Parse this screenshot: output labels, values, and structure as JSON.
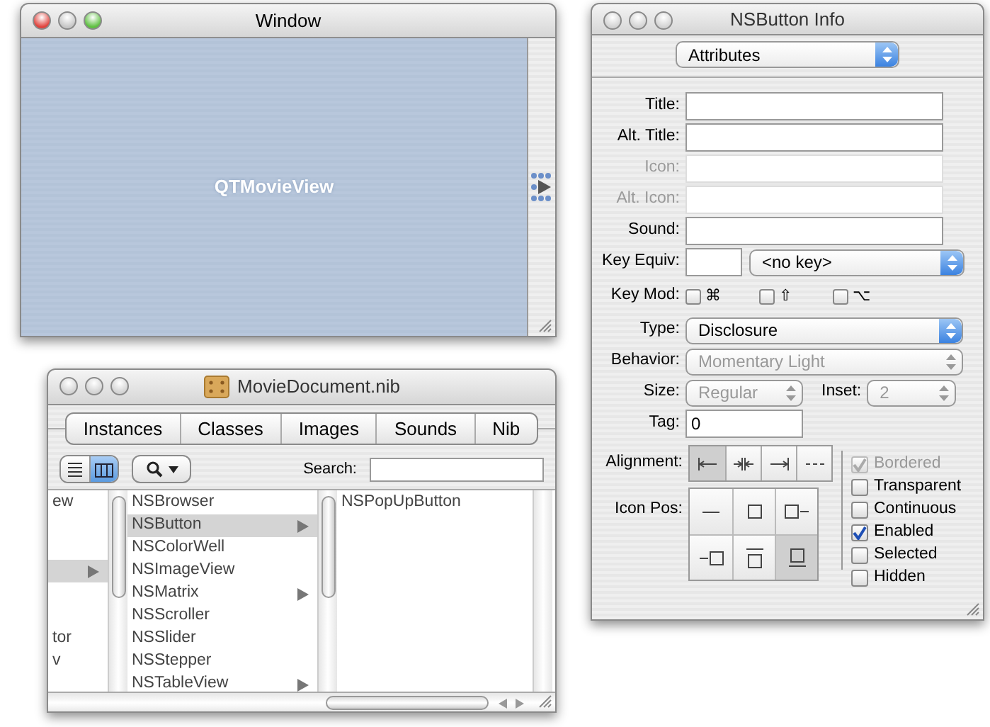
{
  "design_window": {
    "title": "Window",
    "active": true,
    "view_label": "QTMovieView"
  },
  "nib_window": {
    "title": "MovieDocument.nib",
    "active": false,
    "tabs": [
      {
        "label": "Instances"
      },
      {
        "label": "Classes"
      },
      {
        "label": "Images"
      },
      {
        "label": "Sounds"
      },
      {
        "label": "Nib"
      }
    ],
    "view_modes": [
      {
        "kind": "list",
        "selected": false
      },
      {
        "kind": "columns",
        "selected": true
      }
    ],
    "search": {
      "label": "Search:"
    },
    "browser": {
      "columns": [
        {
          "items": [
            {
              "kind": "row",
              "label": "ew",
              "selected": false,
              "has_children": false
            },
            {
              "kind": "blank"
            },
            {
              "kind": "blank"
            },
            {
              "kind": "row",
              "selected": true,
              "has_children": true
            },
            {
              "kind": "blank"
            },
            {
              "kind": "blank"
            },
            {
              "kind": "row",
              "label": "tor",
              "selected": false,
              "has_children": false
            },
            {
              "kind": "row",
              "label": "v",
              "selected": false,
              "has_children": false
            }
          ]
        },
        {
          "items": [
            {
              "label": "NSBrowser",
              "selected": false,
              "has_children": false
            },
            {
              "label": "NSButton",
              "selected": true,
              "has_children": true
            },
            {
              "label": "NSColorWell",
              "selected": false,
              "has_children": false
            },
            {
              "label": "NSImageView",
              "selected": false,
              "has_children": false
            },
            {
              "label": "NSMatrix",
              "selected": false,
              "has_children": true
            },
            {
              "label": "NSScroller",
              "selected": false,
              "has_children": false
            },
            {
              "label": "NSSlider",
              "selected": false,
              "has_children": false
            },
            {
              "label": "NSStepper",
              "selected": false,
              "has_children": false
            },
            {
              "label": "NSTableView",
              "selected": false,
              "has_children": true
            }
          ]
        },
        {
          "items": [
            {
              "label": "NSPopUpButton",
              "selected": false,
              "has_children": false
            }
          ]
        }
      ]
    }
  },
  "inspector": {
    "title": "NSButton Info",
    "active": false,
    "panel": "Attributes",
    "text_fields": [
      {
        "label": "Title:",
        "disabled": false
      },
      {
        "label": "Alt. Title:",
        "disabled": false
      },
      {
        "label": "Icon:",
        "disabled": true
      },
      {
        "label": "Alt. Icon:",
        "disabled": true
      },
      {
        "label": "Sound:",
        "disabled": false
      }
    ],
    "key_equiv": {
      "label": "Key Equiv:",
      "popup": "<no key>"
    },
    "key_mod": {
      "label": "Key Mod:",
      "options": [
        {
          "symbol": "⌘",
          "checked": false
        },
        {
          "symbol": "⇧",
          "checked": false
        },
        {
          "symbol": "⌥",
          "checked": false
        }
      ]
    },
    "popups": [
      {
        "label": "Type:",
        "value": "Disclosure",
        "disabled": false
      },
      {
        "label": "Behavior:",
        "value": "Momentary Light",
        "disabled": true
      }
    ],
    "size": {
      "label": "Size:",
      "value": "Regular",
      "disabled": true
    },
    "inset": {
      "label": "Inset:",
      "value": "2",
      "disabled": true
    },
    "tag": {
      "label": "Tag:",
      "value": "0"
    },
    "alignment": {
      "label": "Alignment:",
      "options": [
        {
          "kind": "left",
          "selected": true
        },
        {
          "kind": "center",
          "selected": false
        },
        {
          "kind": "right",
          "selected": false
        },
        {
          "kind": "natural",
          "selected": false
        }
      ]
    },
    "icon_pos": {
      "label": "Icon Pos:",
      "options": [
        {
          "kind": "none",
          "selected": false
        },
        {
          "kind": "only",
          "selected": false
        },
        {
          "kind": "left",
          "selected": false
        },
        {
          "kind": "right",
          "selected": false
        },
        {
          "kind": "below",
          "selected": false
        },
        {
          "kind": "above",
          "selected": true
        }
      ]
    },
    "options": [
      {
        "label": "Bordered",
        "checked": true,
        "disabled": true
      },
      {
        "label": "Transparent",
        "checked": false,
        "disabled": false
      },
      {
        "label": "Continuous",
        "checked": false,
        "disabled": false
      },
      {
        "label": "Enabled",
        "checked": true,
        "disabled": false
      },
      {
        "label": "Selected",
        "checked": false,
        "disabled": false
      },
      {
        "label": "Hidden",
        "checked": false,
        "disabled": false
      }
    ]
  }
}
